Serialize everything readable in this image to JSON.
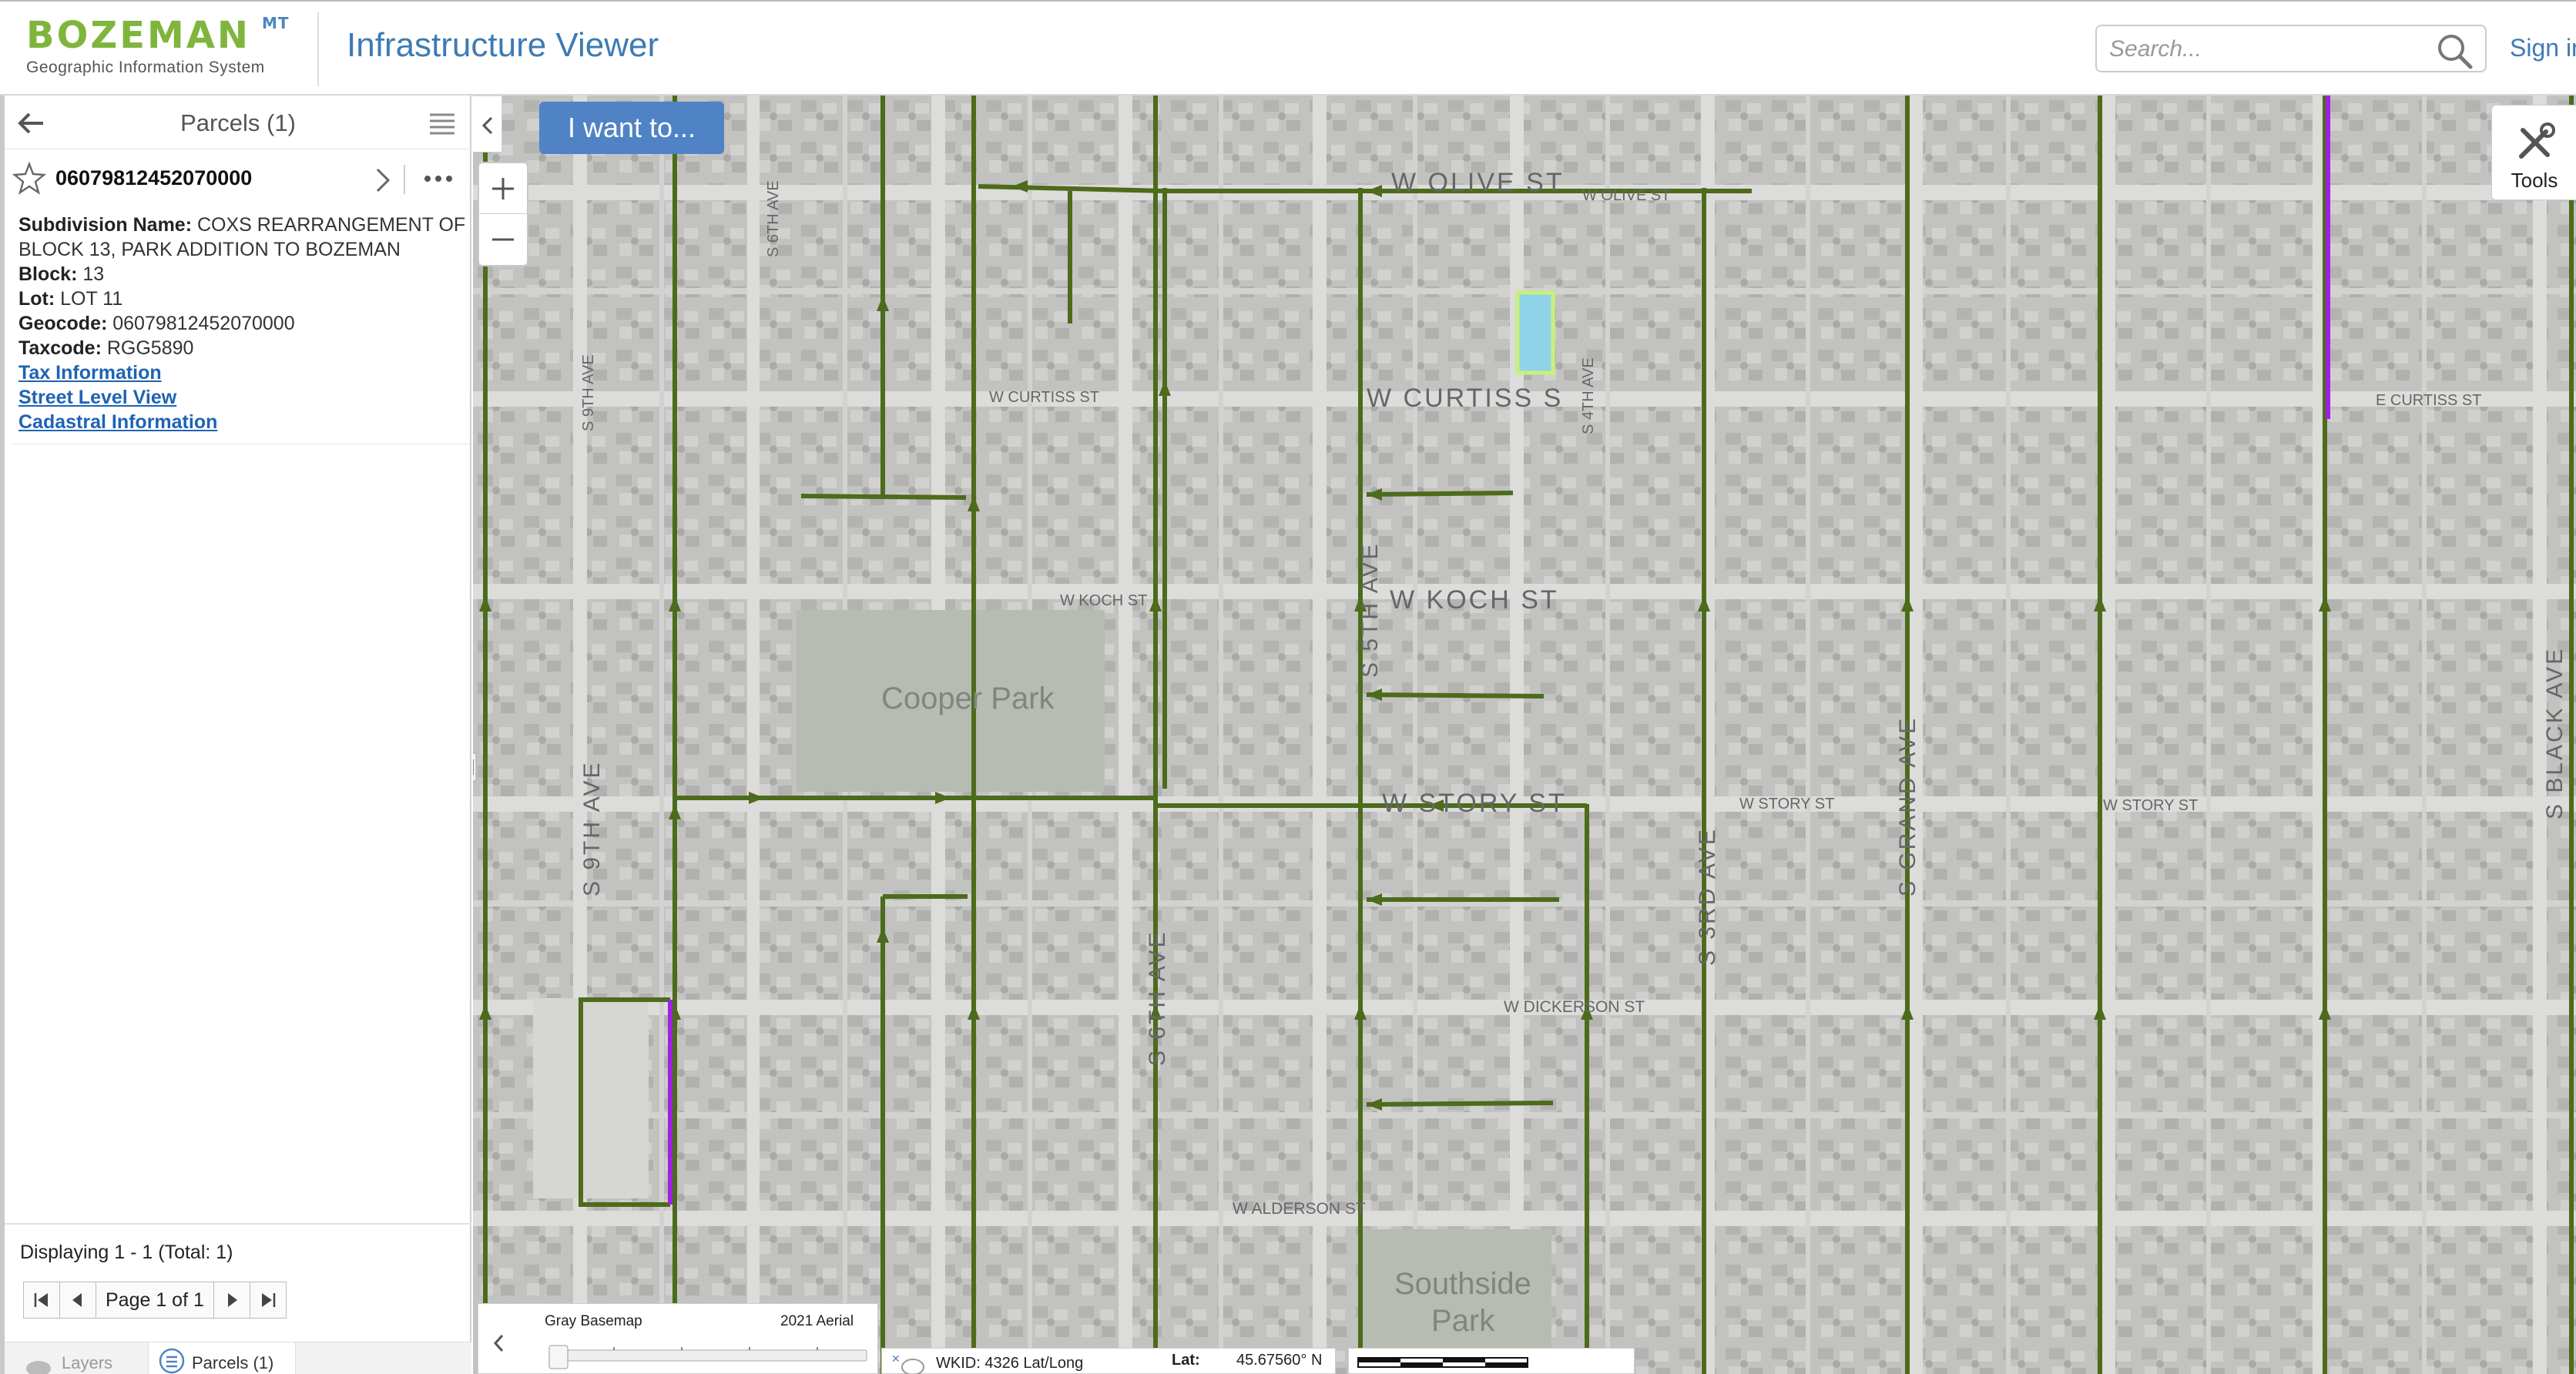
{
  "header": {
    "logo_text": "BOZEMAN",
    "logo_superscript": "MT",
    "logo_subtitle": "Geographic Information System",
    "app_title": "Infrastructure Viewer",
    "search_placeholder": "Search...",
    "sign_in": "Sign in"
  },
  "panel": {
    "title": "Parcels (1)",
    "record_id": "06079812452070000",
    "details": {
      "subdivision_label": "Subdivision Name:",
      "subdivision_value": "COXS REARRANGEMENT OF BLOCK 13, PARK ADDITION TO BOZEMAN",
      "block_label": "Block:",
      "block_value": "13",
      "lot_label": "Lot:",
      "lot_value": "LOT 11",
      "geocode_label": "Geocode:",
      "geocode_value": "06079812452070000",
      "taxcode_label": "Taxcode:",
      "taxcode_value": "RGG5890"
    },
    "links": [
      "Tax Information",
      "Street Level View",
      "Cadastral Information"
    ],
    "displaying": "Displaying 1 - 1 (Total: 1)",
    "page_label": "Page 1 of 1",
    "tabs": {
      "layers": "Layers",
      "parcels": "Parcels (1)"
    }
  },
  "map": {
    "i_want_to": "I want to...",
    "tools_label": "Tools",
    "basemap_left": "Gray Basemap",
    "basemap_right": "2021 Aerial",
    "coord_wkid": "WKID: 4326 Lat/Long",
    "lat_label": "Lat:",
    "lat_value": "45.67560° N",
    "labels": {
      "w_olive": "W OLIVE ST",
      "w_olive_small": "W OLIVE ST",
      "w_curtiss_small": "W CURTISS ST",
      "w_curtiss": "W CURTISS S",
      "e_curtiss": "E CURTISS ST",
      "w_koch_small": "W KOCH ST",
      "w_koch": "W KOCH ST",
      "cooper_park": "Cooper Park",
      "w_story": "W STORY ST",
      "w_story_2": "W STORY ST",
      "w_story_3": "W STORY ST",
      "w_dickerson": "W DICKERSON ST",
      "w_alderson": "W ALDERSON ST",
      "southside_park_1": "Southside",
      "southside_park_2": "Park",
      "s_9th_ave": "S 9TH AVE",
      "s_9th_ave_2": "S 9TH AVE",
      "s_6th_ave": "S 6TH AVE",
      "s_6th_ave_2": "S 6TH AVE",
      "s_5th_ave": "S 5TH AVE",
      "s_4th_ave": "S 4TH AVE",
      "s_3rd_ave": "S 3RD AVE",
      "s_grand_ave": "S GRAND AVE",
      "s_black_ave": "S BLACK AVE"
    }
  },
  "colors": {
    "brand_green": "#7fb53c",
    "brand_blue": "#3d7bb4",
    "pipe_green": "#4d6b1c",
    "pipe_purple": "#a020e0",
    "parcel_highlight": "#7fd8ff",
    "button_blue": "#4f83c5"
  }
}
